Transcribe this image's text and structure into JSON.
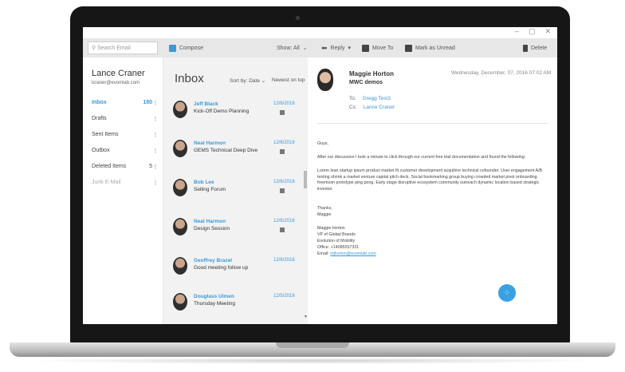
{
  "toolbar": {
    "search_placeholder": "Search Email",
    "compose_label": "Compose",
    "show_label": "Show: All",
    "reply_label": "Reply",
    "move_label": "Move To",
    "mark_unread_label": "Mark as Unread",
    "delete_label": "Delete"
  },
  "window": {
    "minimize": "–",
    "maximize": "▢",
    "close": "✕"
  },
  "sidebar": {
    "user_name": "Lance Craner",
    "user_email": "lcraner@evomlab.com",
    "folders": [
      {
        "name": "Inbox",
        "count": "180"
      },
      {
        "name": "Drafts",
        "count": ""
      },
      {
        "name": "Sent Items",
        "count": ""
      },
      {
        "name": "Outbox",
        "count": ""
      },
      {
        "name": "Deleted Items",
        "count": "5"
      },
      {
        "name": "Junk E-Mail",
        "count": ""
      }
    ]
  },
  "list": {
    "title": "Inbox",
    "sort_label": "Sort by: Date",
    "newest_label": "Newest on top",
    "messages": [
      {
        "sender": "Jeff Black",
        "subject": "Kick-Off Demo Planning",
        "date": "12/6/2016"
      },
      {
        "sender": "Neal Harmon",
        "subject": "GEMS Technical Deep Dive",
        "date": "12/6/2016"
      },
      {
        "sender": "Bob Lee",
        "subject": "Selling Forum",
        "date": "12/6/2016"
      },
      {
        "sender": "Neal Harmon",
        "subject": "Design Session",
        "date": "12/6/2016"
      },
      {
        "sender": "Geoffrey Brazel",
        "subject": "Good meeting follow up",
        "date": "12/6/2016"
      },
      {
        "sender": "Douglass Ulmen",
        "subject": "Thursday Meeting",
        "date": "12/5/2016"
      }
    ]
  },
  "reader": {
    "sender": "Maggie Horton",
    "subject": "MWC demos",
    "date": "Wednesday, December, 07, 2016 07:02 AM",
    "to_label": "To:",
    "to_value": "Gregg Test3",
    "cc_label": "Cc:",
    "cc_value": "Lance Craner",
    "greeting": "Guys,",
    "para1": "After our discussion I took a minute to click through our current free trial documentation and found the following:",
    "para2": "Lorem lean startup ipsum product market fit customer development acquihire technical cofounder. User engagement A/B testing shrink a market venture capital pitch deck. Social bookmarking group buying crowded market pivot onboarding freemium prototype ping pong. Early stage disruptive ecosystem community outreach dynamic location based strategic investor.",
    "thanks": "Thanks,",
    "sign_name": "Maggie",
    "sig_name": "Maggie Horton",
    "sig_title": "VP of Global Brands",
    "sig_company": "Evolution of Mobility",
    "sig_office": "Office: +14085557331",
    "sig_email_label": "Email:",
    "sig_email": "mjhorton@evomlab.com"
  }
}
